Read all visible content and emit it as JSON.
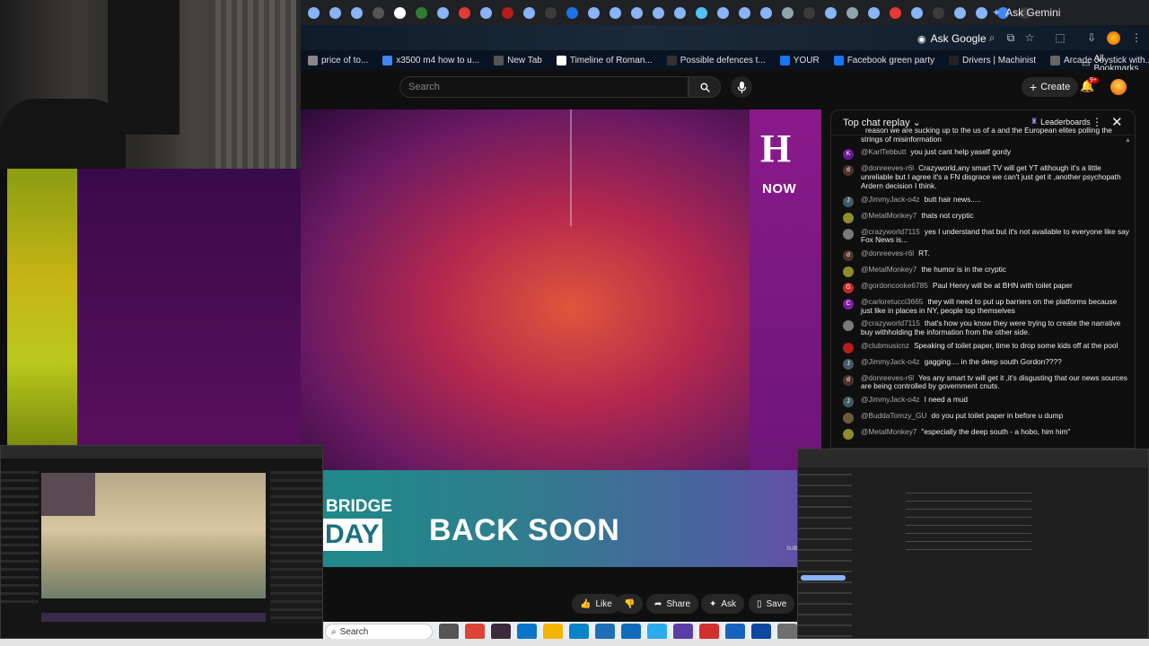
{
  "browser": {
    "tab_icons": [
      "chrome",
      "chrome",
      "chrome",
      "dark-grid",
      "N",
      "green",
      "chrome",
      "red",
      "chrome",
      "red-dark",
      "chrome",
      "dark",
      "blue",
      "chrome",
      "chrome",
      "chrome",
      "chrome",
      "chrome",
      "blue2",
      "chrome",
      "chrome",
      "chrome",
      "globe",
      "dark",
      "chrome",
      "globe2",
      "chrome",
      "red",
      "chrome",
      "dark",
      "chrome",
      "chrome",
      "blue-gear",
      "dark2"
    ],
    "ask_gemini": "Ask Gemini",
    "ask_google": "Ask Google",
    "bookmarks": [
      {
        "label": "price of to...",
        "color": "#888"
      },
      {
        "label": "x3500 m4 how to u...",
        "color": "#4285f4"
      },
      {
        "label": "New Tab",
        "color": "#555"
      },
      {
        "label": "Timeline of Roman...",
        "color": "#fff"
      },
      {
        "label": "Possible defences t...",
        "color": "#333"
      },
      {
        "label": "YOUR",
        "color": "#1877f2"
      },
      {
        "label": "Facebook green party",
        "color": "#1877f2"
      },
      {
        "label": "Drivers | Machinist",
        "color": "#222"
      },
      {
        "label": "Arcade Joystick with...",
        "color": "#666"
      }
    ],
    "all_bookmarks": "All Bookmarks"
  },
  "youtube": {
    "search_placeholder": "Search",
    "create_label": "Create",
    "notif_count": "9+"
  },
  "video": {
    "logo_letter": "H",
    "logo_sub": "NOW",
    "bridge_text": "BRIDGE",
    "day_text": "DAY",
    "back_soon": "BACK SOON",
    "sub_text": "SUB"
  },
  "chat": {
    "title": "Top chat replay",
    "leaderboards": "Leaderboards",
    "messages": [
      {
        "author": "",
        "text": "reason we are sucking up to the us of a and the European elites polling the strings of misinformation",
        "avatar": "",
        "color": ""
      },
      {
        "author": "@KarlTebbutt",
        "text": "you just cant help yaself gordy",
        "avatar": "K",
        "color": "#6a1b9a"
      },
      {
        "author": "@donreeves-r6l",
        "text": "Crazyworld,any smart TV will get YT although it's a little unreliable but I agree it's a FN disgrace we can't just get it ,another psychopath Ardern decision I think.",
        "avatar": "d",
        "color": "#4e342e"
      },
      {
        "author": "@JimmyJack-o4z",
        "text": "butt hair news.....",
        "avatar": "J",
        "color": "#455a64"
      },
      {
        "author": "@MetalMonkey7",
        "text": "thats not cryptic",
        "avatar": "",
        "color": "#8d8d2a"
      },
      {
        "author": "@crazyworld7115",
        "text": "yes I understand that but it's not available to everyone like say Fox News is...",
        "avatar": "",
        "color": "#7a7a7a"
      },
      {
        "author": "@donreeves-r6l",
        "text": "RT.",
        "avatar": "d",
        "color": "#4e342e"
      },
      {
        "author": "@MetalMonkey7",
        "text": "the humor is in the cryptic",
        "avatar": "",
        "color": "#8d8d2a"
      },
      {
        "author": "@gordoncooke6785",
        "text": "Paul Henry will be at BHN with toilet paper",
        "avatar": "G",
        "color": "#c62828"
      },
      {
        "author": "@carloretucci3665",
        "text": "they will need to put up barriers on the platforms because just like in places in NY, people top themselves",
        "avatar": "C",
        "color": "#7b1fa2"
      },
      {
        "author": "@crazyworld7115",
        "text": "that's how you know they were trying to create the narrative buy withholding the information from the other side.",
        "avatar": "",
        "color": "#7a7a7a"
      },
      {
        "author": "@clubmusicnz",
        "text": "Speaking of toilet paper, time to drop some kids off at the pool",
        "avatar": "",
        "color": "#b71c1c"
      },
      {
        "author": "@JimmyJack-o4z",
        "text": "gagging.... in the deep south Gordon????",
        "avatar": "J",
        "color": "#455a64"
      },
      {
        "author": "@donreeves-r6l",
        "text": "Yes any smart tv will get it ,it's disgusting that our news sources are being controlled by government cnuts.",
        "avatar": "d",
        "color": "#4e342e"
      },
      {
        "author": "@JimmyJack-o4z",
        "text": "I need a mud",
        "avatar": "J",
        "color": "#455a64"
      },
      {
        "author": "@BuddaTomzy_GU",
        "text": "do you put toilet paper in before u dump",
        "avatar": "",
        "color": "#6d5a3a"
      },
      {
        "author": "@MetalMonkey7",
        "text": "\"especially the deep south - a hobo, him him\"",
        "avatar": "",
        "color": "#8d8d2a"
      }
    ]
  },
  "actions": {
    "like": "Like",
    "share": "Share",
    "ask": "Ask",
    "save": "Save"
  },
  "taskbar": {
    "search": "Search",
    "apps": [
      {
        "name": "files",
        "color": "#555"
      },
      {
        "name": "chrome",
        "color": "#db4437"
      },
      {
        "name": "obs",
        "color": "#3a2a3a"
      },
      {
        "name": "ms-store",
        "color": "#0a74c9"
      },
      {
        "name": "explorer",
        "color": "#f4b400"
      },
      {
        "name": "edge",
        "color": "#0a84c9"
      },
      {
        "name": "vscode",
        "color": "#1e6fb8"
      },
      {
        "name": "outlook",
        "color": "#0f6cbd"
      },
      {
        "name": "telegram",
        "color": "#2aabee"
      },
      {
        "name": "purple",
        "color": "#5b3ea8"
      },
      {
        "name": "red-bolt",
        "color": "#d32f2f"
      },
      {
        "name": "photos",
        "color": "#1565c0"
      },
      {
        "name": "mail",
        "color": "#0d47a1"
      },
      {
        "name": "settings",
        "color": "#6f6f6f"
      }
    ]
  }
}
